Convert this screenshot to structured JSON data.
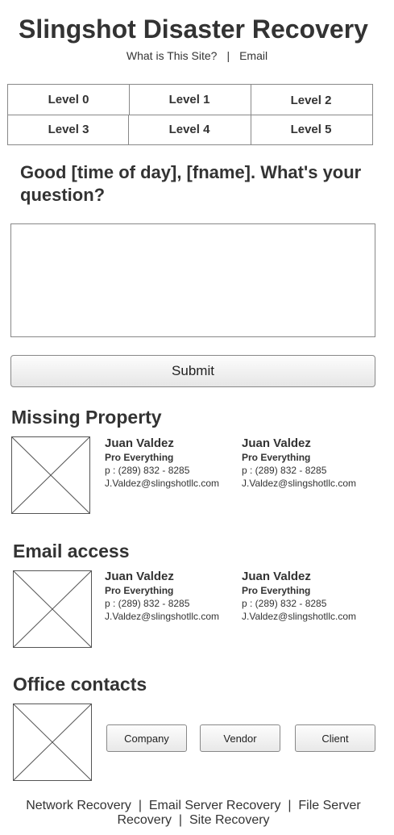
{
  "header": {
    "title": "Slingshot Disaster Recovery",
    "nav": {
      "about": "What is This Site?",
      "separator": "|",
      "email": "Email"
    }
  },
  "levels": [
    "Level 0",
    "Level 1",
    "Level 2",
    "Level 3",
    "Level 4",
    "Level 5"
  ],
  "question": {
    "prompt": "Good [time of day], [fname]. What's your question?",
    "input_value": "",
    "submit_label": "Submit"
  },
  "sections": {
    "missing_property": {
      "title": "Missing Property",
      "contacts": [
        {
          "name": "Juan Valdez",
          "role": "Pro Everything",
          "phone": "p : (289) 832 - 8285",
          "email": "J.Valdez@slingshotllc.com"
        },
        {
          "name": "Juan Valdez",
          "role": "Pro Everything",
          "phone": "p : (289) 832 - 8285",
          "email": "J.Valdez@slingshotllc.com"
        }
      ]
    },
    "email_access": {
      "title": "Email access",
      "contacts": [
        {
          "name": "Juan Valdez",
          "role": "Pro Everything",
          "phone": "p : (289) 832 - 8285",
          "email": "J.Valdez@slingshotllc.com"
        },
        {
          "name": "Juan Valdez",
          "role": "Pro Everything",
          "phone": "p : (289) 832 - 8285",
          "email": "J.Valdez@slingshotllc.com"
        }
      ]
    },
    "office_contacts": {
      "title": "Office contacts",
      "buttons": [
        "Company",
        "Vendor",
        "Client"
      ]
    }
  },
  "footer": {
    "links": [
      "Network Recovery",
      "Email Server Recovery",
      "File Server Recovery",
      "Site Recovery"
    ],
    "separator": "|"
  }
}
